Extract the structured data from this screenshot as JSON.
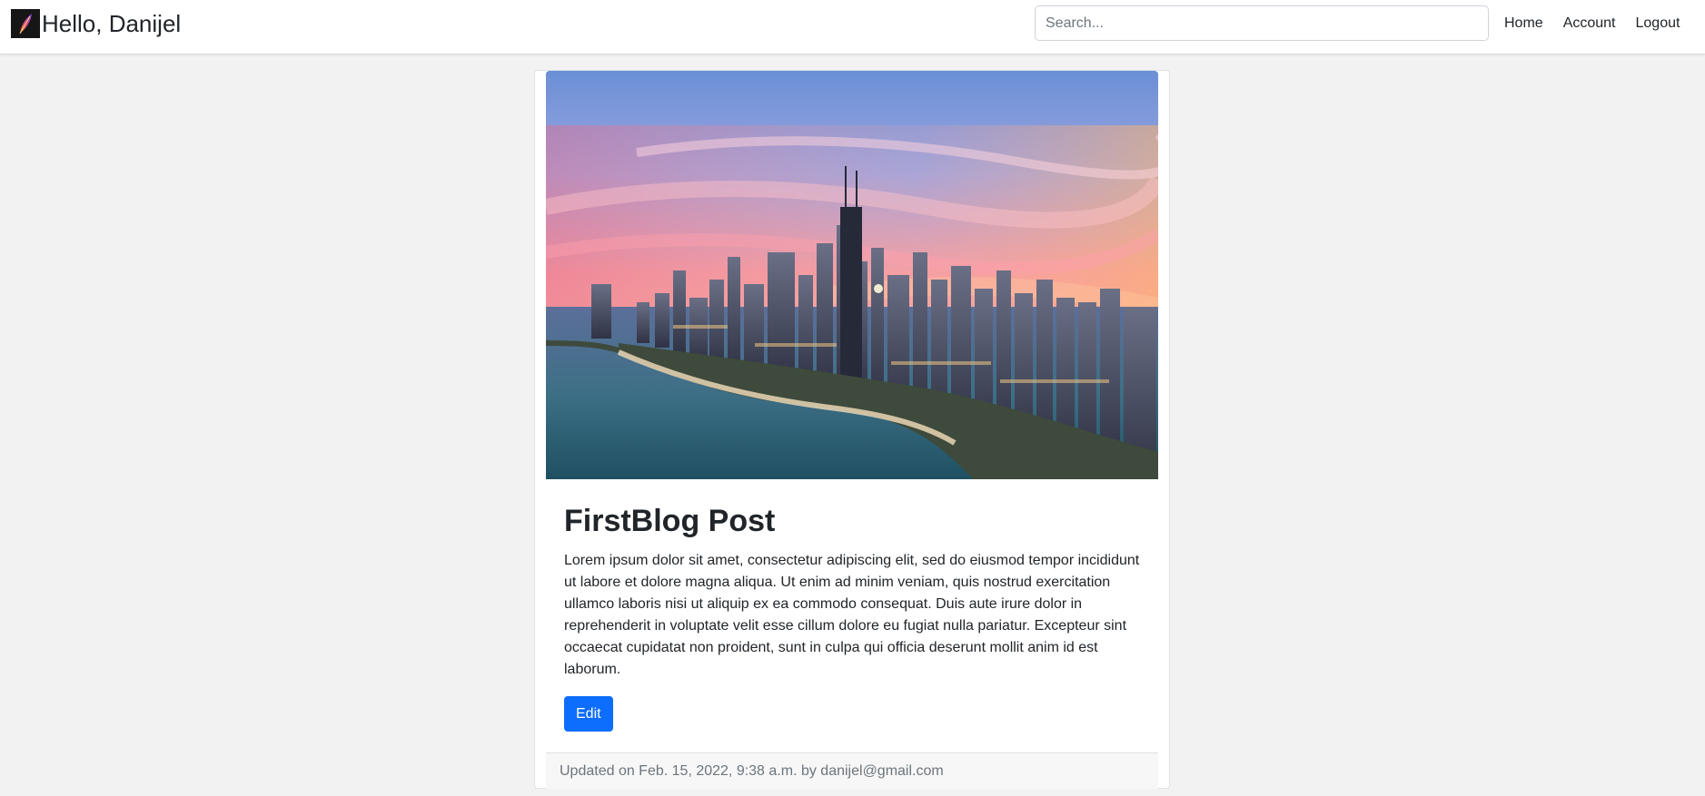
{
  "navbar": {
    "brand_text": "Hello, Danijel",
    "search_placeholder": "Search...",
    "links": {
      "home": "Home",
      "account": "Account",
      "logout": "Logout"
    }
  },
  "post": {
    "title": "FirstBlog Post",
    "body": "Lorem ipsum dolor sit amet, consectetur adipiscing elit, sed do eiusmod tempor incididunt ut labore et dolore magna aliqua. Ut enim ad minim veniam, quis nostrud exercitation ullamco laboris nisi ut aliquip ex ea commodo consequat. Duis aute irure dolor in reprehenderit in voluptate velit esse cillum dolore eu fugiat nulla pariatur. Excepteur sint occaecat cupidatat non proident, sunt in culpa qui officia deserunt mollit anim id est laborum.",
    "edit_label": "Edit",
    "footer": "Updated on Feb. 15, 2022, 9:38 a.m. by danijel@gmail.com"
  },
  "colors": {
    "primary": "#0d6efd",
    "page_background": "#f2f2f2",
    "muted_text": "#6c757d"
  },
  "icons": {
    "brand_logo": "feather-logo-icon"
  }
}
